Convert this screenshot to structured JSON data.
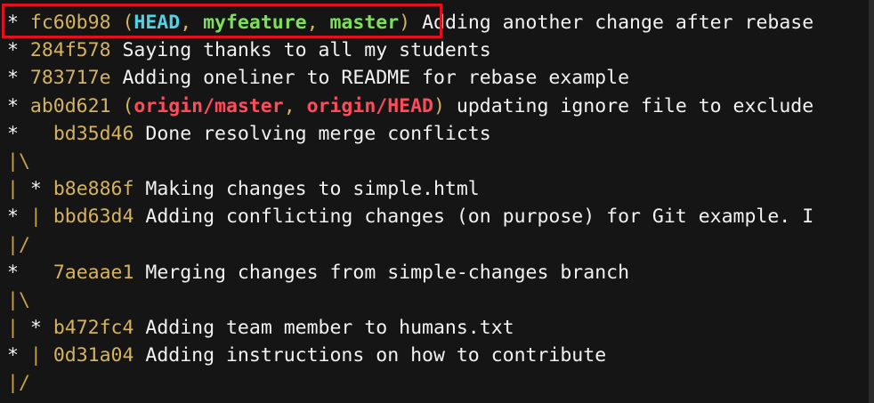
{
  "commits": [
    {
      "graph": "* ",
      "hash": "fc60b98",
      "refs": [
        {
          "name": "HEAD",
          "kind": "head"
        },
        {
          "name": "myfeature",
          "kind": "branch"
        },
        {
          "name": "master",
          "kind": "branch"
        }
      ],
      "message": "Adding another change after rebase"
    },
    {
      "graph": "* ",
      "hash": "284f578",
      "refs": [],
      "message": "Saying thanks to all my students"
    },
    {
      "graph": "* ",
      "hash": "783717e",
      "refs": [],
      "message": "Adding oneliner to README for rebase example"
    },
    {
      "graph": "* ",
      "hash": "ab0d621",
      "refs": [
        {
          "name": "origin/master",
          "kind": "remote"
        },
        {
          "name": "origin/HEAD",
          "kind": "remote"
        }
      ],
      "message": "updating ignore file to exclude"
    },
    {
      "graph": "*   ",
      "hash": "bd35d46",
      "refs": [],
      "message": "Done resolving merge conflicts"
    },
    {
      "graph": "|\\",
      "hash": "",
      "refs": [],
      "message": ""
    },
    {
      "graph": "| * ",
      "hash": "b8e886f",
      "refs": [],
      "message": "Making changes to simple.html"
    },
    {
      "graph": "* | ",
      "hash": "bbd63d4",
      "refs": [],
      "message": "Adding conflicting changes (on purpose) for Git example. I"
    },
    {
      "graph": "|/",
      "hash": "",
      "refs": [],
      "message": ""
    },
    {
      "graph": "*   ",
      "hash": "7aeaae1",
      "refs": [],
      "message": "Merging changes from simple-changes branch"
    },
    {
      "graph": "|\\",
      "hash": "",
      "refs": [],
      "message": ""
    },
    {
      "graph": "| * ",
      "hash": "b472fc4",
      "refs": [],
      "message": "Adding team member to humans.txt"
    },
    {
      "graph": "* | ",
      "hash": "0d31a04",
      "refs": [],
      "message": "Adding instructions on how to contribute"
    },
    {
      "graph": "|/",
      "hash": "",
      "refs": [],
      "message": ""
    }
  ],
  "colors": {
    "hash": "#d6b35e",
    "head_ref": "#4fd3e6",
    "branch_ref": "#7ee05a",
    "remote_ref": "#ff4b5a",
    "highlight": "#e0121e"
  }
}
